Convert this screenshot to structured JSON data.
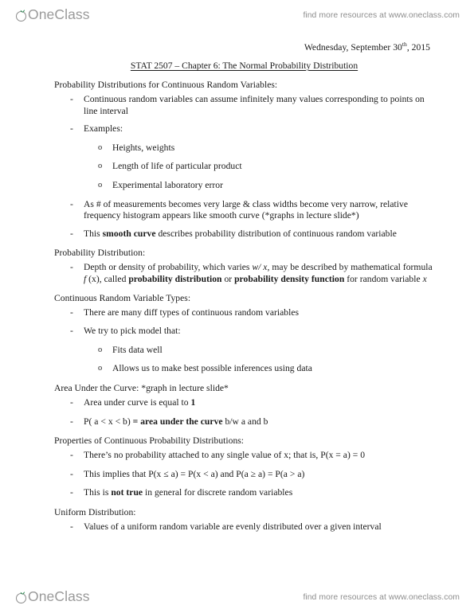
{
  "watermark": {
    "logo_text": "OneClass",
    "logo_icon": "oneclass-sprout-logo",
    "tagline": "find more resources at www.oneclass.com"
  },
  "document": {
    "date": "Wednesday, September 30",
    "date_suffix": "th",
    "date_year": ", 2015",
    "title": "STAT 2507 – Chapter 6: The Normal Probability Distribution",
    "sections": [
      {
        "heading": "Probability Distributions for Continuous Random Variables:",
        "bullets": [
          {
            "text": "Continuous random variables can assume infinitely many values corresponding to points on line interval"
          },
          {
            "text": "Examples:",
            "subbullets": [
              "Heights, weights",
              "Length of life of particular product",
              "Experimental laboratory error"
            ]
          },
          {
            "text": "As # of measurements becomes very large & class widths become very narrow, relative frequency histogram appears like smooth curve (*graphs in lecture slide*)"
          },
          {
            "text_pre": "This ",
            "text_bold": "smooth curve",
            "text_post": " describes probability distribution of continuous random variable"
          }
        ]
      },
      {
        "heading": "Probability Distribution:",
        "bullets": [
          {
            "rich": "depth-density-formula"
          }
        ]
      },
      {
        "heading": "Continuous Random Variable Types:",
        "bullets": [
          {
            "text": "There are many diff types of continuous random variables"
          },
          {
            "text": "We try to pick model that:",
            "subbullets": [
              "Fits data well",
              "Allows us to make best possible inferences using data"
            ]
          }
        ]
      },
      {
        "heading": "Area Under the Curve: *graph in lecture slide*",
        "bullets": [
          {
            "text_pre": "Area under curve is equal to ",
            "text_bold": "1",
            "text_post": ""
          },
          {
            "text_pre": "P( a < x < b) ",
            "text_bold": "= area under the curve",
            "text_post": " b/w a and b"
          }
        ]
      },
      {
        "heading": "Properties of Continuous Probability Distributions:",
        "bullets": [
          {
            "text": "There’s no probability attached to any single value of x; that is, P(x = a) = 0"
          },
          {
            "text": "This implies that P(x ≤ a) = P(x < a) and P(a ≥ a) = P(a > a)"
          },
          {
            "text_pre": "This is ",
            "text_bold": "not true",
            "text_post": " in general for discrete random variables"
          }
        ]
      },
      {
        "heading": "Uniform Distribution:",
        "bullets": [
          {
            "text": "Values of a uniform random variable are evenly distributed over a given interval"
          }
        ]
      }
    ],
    "prob_dist_bullet": {
      "p1": "Depth or density of probability, which varies ",
      "i1": "w/ x",
      "p2": ", may be described by mathematical formula ",
      "i2": "f",
      "p3": " (x), called ",
      "b1": "probability distribution",
      "p4": " or ",
      "b2": "probability density function",
      "p5": " for random variable ",
      "i3": "x"
    }
  },
  "colors": {
    "logo_gray": "#9a9a9a",
    "leaf_green": "#2f8f55",
    "text": "#1a1a1a"
  }
}
